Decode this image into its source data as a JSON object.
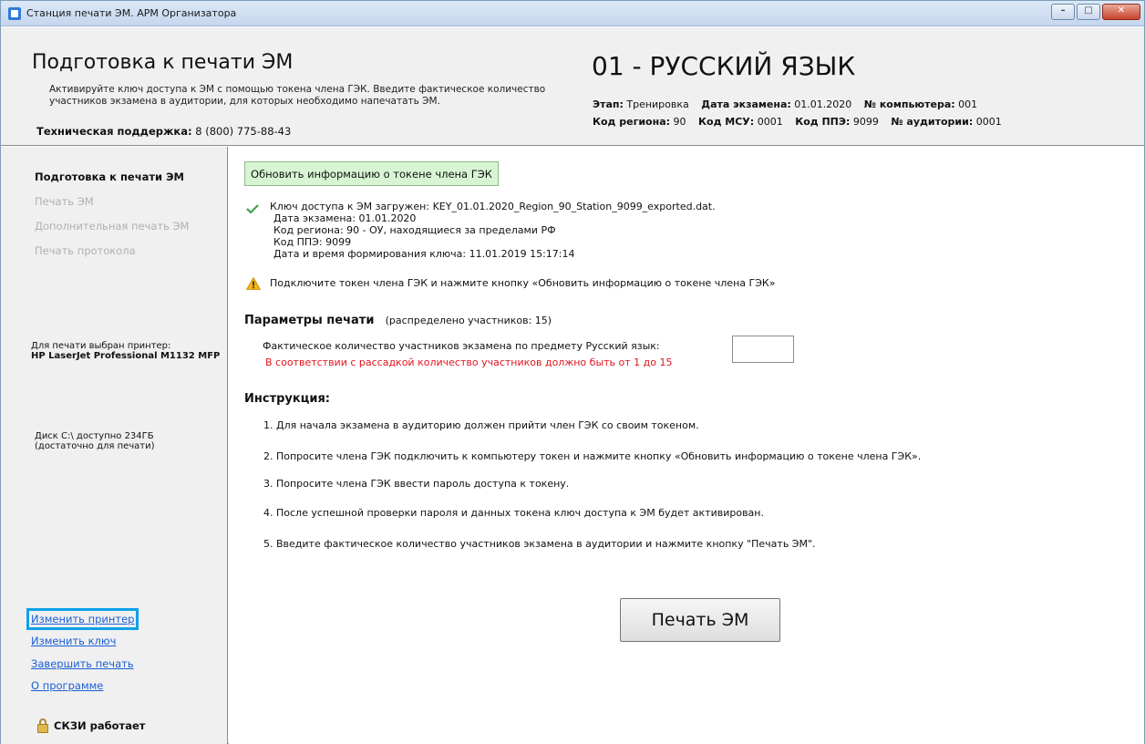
{
  "window": {
    "title": "Станция печати ЭМ. АРМ Организатора"
  },
  "header": {
    "title": "Подготовка к печати ЭМ",
    "description": "Активируйте ключ доступа к ЭМ с помощью токена члена ГЭК. Введите фактическое количество участников экзамена в аудитории, для которых необходимо напечатать ЭМ.",
    "support_label": "Техническая поддержка:",
    "support_phone": "8 (800) 775-88-43",
    "subject": "01 - РУССКИЙ ЯЗЫК",
    "stage_label": "Этап:",
    "stage_value": "Тренировка",
    "exam_date_label": "Дата экзамена:",
    "exam_date_value": "01.01.2020",
    "computer_label": "№ компьютера:",
    "computer_value": "001",
    "region_label": "Код региона:",
    "region_value": "90",
    "msu_label": "Код МСУ:",
    "msu_value": "0001",
    "ppe_label": "Код ППЭ:",
    "ppe_value": "9099",
    "auditorium_label": "№ аудитории:",
    "auditorium_value": "0001"
  },
  "sidebar": {
    "nav": [
      {
        "label": "Подготовка к печати ЭМ",
        "active": true
      },
      {
        "label": "Печать ЭМ",
        "active": false
      },
      {
        "label": "Дополнительная печать ЭМ",
        "active": false
      },
      {
        "label": "Печать протокола",
        "active": false
      }
    ],
    "printer_label": "Для печати выбран принтер:",
    "printer_name": "HP LaserJet Professional M1132 MFP",
    "disk_line1": "Диск C:\\ доступно 234ГБ",
    "disk_line2": "(достаточно для печати)",
    "links": [
      "Изменить принтер",
      "Изменить ключ",
      "Завершить печать",
      "О программе"
    ],
    "skzi_status": "СКЗИ работает"
  },
  "main": {
    "refresh_button": "Обновить информацию о токене члена ГЭК",
    "key_info": {
      "loaded": "Ключ доступа к ЭМ загружен: KEY_01.01.2020_Region_90_Station_9099_exported.dat.",
      "exam_date": "Дата экзамена: 01.01.2020",
      "region": "Код региона: 90 - ОУ, находящиеся за пределами РФ",
      "ppe": "Код ППЭ: 9099",
      "generated": "Дата и время формирования ключа: 11.01.2019 15:17:14"
    },
    "warning": "Подключите токен члена ГЭК и нажмите кнопку «Обновить информацию о токене члена ГЭК»",
    "params_title": "Параметры печати",
    "params_sub": "(распределено участников: 15)",
    "count_label": "Фактическое количество участников экзамена по предмету Русский язык:",
    "count_value": "",
    "count_error": "В соответствии с рассадкой количество участников должно быть от 1 до 15",
    "instructions_title": "Инструкция:",
    "instructions": [
      "1. Для начала экзамена в аудиторию должен прийти член ГЭК со своим токеном.",
      "2. Попросите члена ГЭК подключить к компьютеру токен и нажмите кнопку «Обновить информацию о токене члена ГЭК».",
      "3. Попросите члена ГЭК ввести пароль доступа к токену.",
      "4. После успешной проверки пароля и данных токена ключ доступа к ЭМ будет активирован.",
      "5. Введите фактическое количество участников экзамена в аудитории и нажмите кнопку \"Печать ЭМ\"."
    ],
    "print_button": "Печать ЭМ"
  },
  "colors": {
    "error": "#e0141e",
    "link": "#1a5fd6",
    "highlight": "#0ea1e8",
    "refresh_button_bg": "#d7f5d3"
  }
}
